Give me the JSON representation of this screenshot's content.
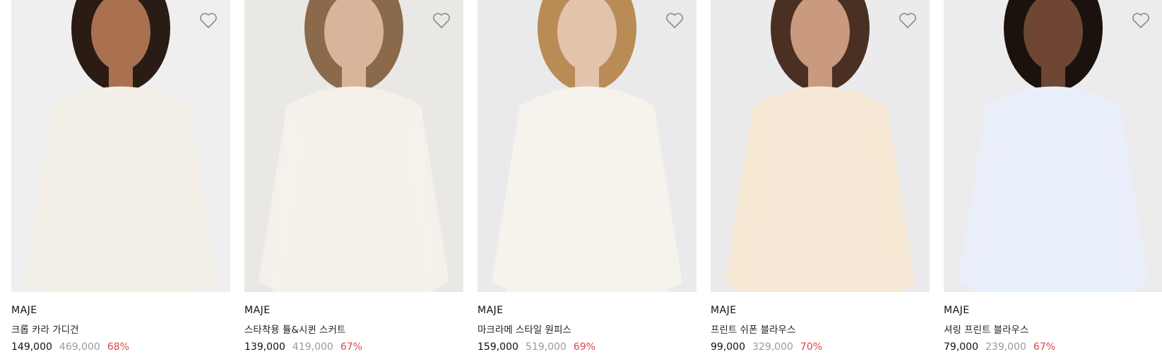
{
  "products": [
    {
      "brand": "MAJE",
      "name": "크롭 카라 가디건",
      "sale_price": "149,000",
      "original_price": "469,000",
      "discount": "68%",
      "image_icon": "model-cardigan-image",
      "colors": {
        "bg": "#efefef",
        "garment": "#f3efe6",
        "skin": "#a9714f",
        "hair": "#2a1c14"
      }
    },
    {
      "brand": "MAJE",
      "name": "스타착용 튤&시퀸 스커트",
      "sale_price": "139,000",
      "original_price": "419,000",
      "discount": "67%",
      "image_icon": "model-skirt-image",
      "colors": {
        "bg": "#e9e8e5",
        "garment": "#f4f1ea",
        "skin": "#d9b39a",
        "hair": "#8a6a4a"
      }
    },
    {
      "brand": "MAJE",
      "name": "마크라메 스타일 원피스",
      "sale_price": "159,000",
      "original_price": "519,000",
      "discount": "69%",
      "image_icon": "model-dress-image",
      "colors": {
        "bg": "#eaeaec",
        "garment": "#f6f3ec",
        "skin": "#e4c3ad",
        "hair": "#b98b55"
      }
    },
    {
      "brand": "MAJE",
      "name": "프린트 쉬폰 블라우스",
      "sale_price": "99,000",
      "original_price": "329,000",
      "discount": "70%",
      "image_icon": "model-blouse-image",
      "colors": {
        "bg": "#ebebed",
        "garment": "#f6e8d4",
        "skin": "#c99a7d",
        "hair": "#4a3022"
      }
    },
    {
      "brand": "MAJE",
      "name": "셔링 프린트 블라우스",
      "sale_price": "79,000",
      "original_price": "239,000",
      "discount": "67%",
      "image_icon": "model-print-blouse-image",
      "colors": {
        "bg": "#ececec",
        "garment": "#e9eefb",
        "skin": "#6e4633",
        "hair": "#1c120d"
      }
    }
  ],
  "wishlist_icon": "heart-outline-icon"
}
